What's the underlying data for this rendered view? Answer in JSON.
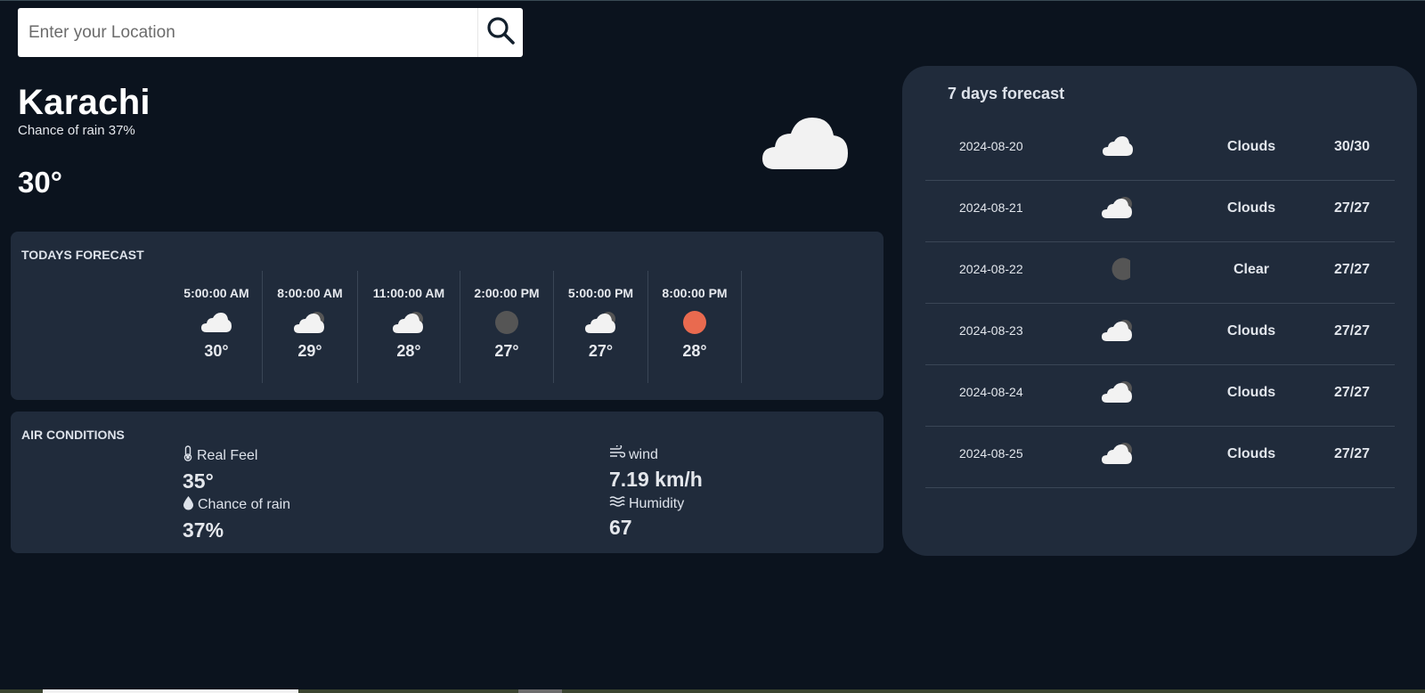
{
  "search": {
    "placeholder": "Enter your Location",
    "value": ""
  },
  "current": {
    "city": "Karachi",
    "rain_text": "Chance of rain 37%",
    "temp": "30°",
    "icon": "cloud-icon"
  },
  "today": {
    "title": "TODAYS FORECAST",
    "hours": [
      {
        "time": "5:00:00 AM",
        "temp": "30°",
        "icon": "cloud-icon"
      },
      {
        "time": "8:00:00 AM",
        "temp": "29°",
        "icon": "cloud-moon-icon"
      },
      {
        "time": "11:00:00 AM",
        "temp": "28°",
        "icon": "cloud-moon-icon"
      },
      {
        "time": "2:00:00 PM",
        "temp": "27°",
        "icon": "moon-icon"
      },
      {
        "time": "5:00:00 PM",
        "temp": "27°",
        "icon": "cloud-moon-icon"
      },
      {
        "time": "8:00:00 PM",
        "temp": "28°",
        "icon": "sun-icon"
      }
    ]
  },
  "air": {
    "title": "AIR CONDITIONS",
    "real_feel": {
      "label": "Real Feel",
      "value": "35°",
      "icon": "thermometer-icon"
    },
    "chance_of_rain": {
      "label": "Chance of rain",
      "value": "37%",
      "icon": "droplet-icon"
    },
    "wind": {
      "label": "wind",
      "value": "7.19 km/h",
      "icon": "wind-icon"
    },
    "humidity": {
      "label": "Humidity",
      "value": "67",
      "icon": "humidity-icon"
    }
  },
  "week": {
    "title": "7 days forecast",
    "days": [
      {
        "date": "2024-08-20",
        "condition": "Clouds",
        "temp": "30/30",
        "icon": "cloud-icon"
      },
      {
        "date": "2024-08-21",
        "condition": "Clouds",
        "temp": "27/27",
        "icon": "cloud-moon-icon"
      },
      {
        "date": "2024-08-22",
        "condition": "Clear",
        "temp": "27/27",
        "icon": "moon-icon"
      },
      {
        "date": "2024-08-23",
        "condition": "Clouds",
        "temp": "27/27",
        "icon": "cloud-moon-icon"
      },
      {
        "date": "2024-08-24",
        "condition": "Clouds",
        "temp": "27/27",
        "icon": "cloud-moon-icon"
      },
      {
        "date": "2024-08-25",
        "condition": "Clouds",
        "temp": "27/27",
        "icon": "cloud-moon-icon"
      }
    ]
  },
  "colors": {
    "background": "#0b131e",
    "panel": "#202b3b",
    "sun": "#e96a4f",
    "moon": "#555555",
    "cloud": "#f2f2f2"
  }
}
